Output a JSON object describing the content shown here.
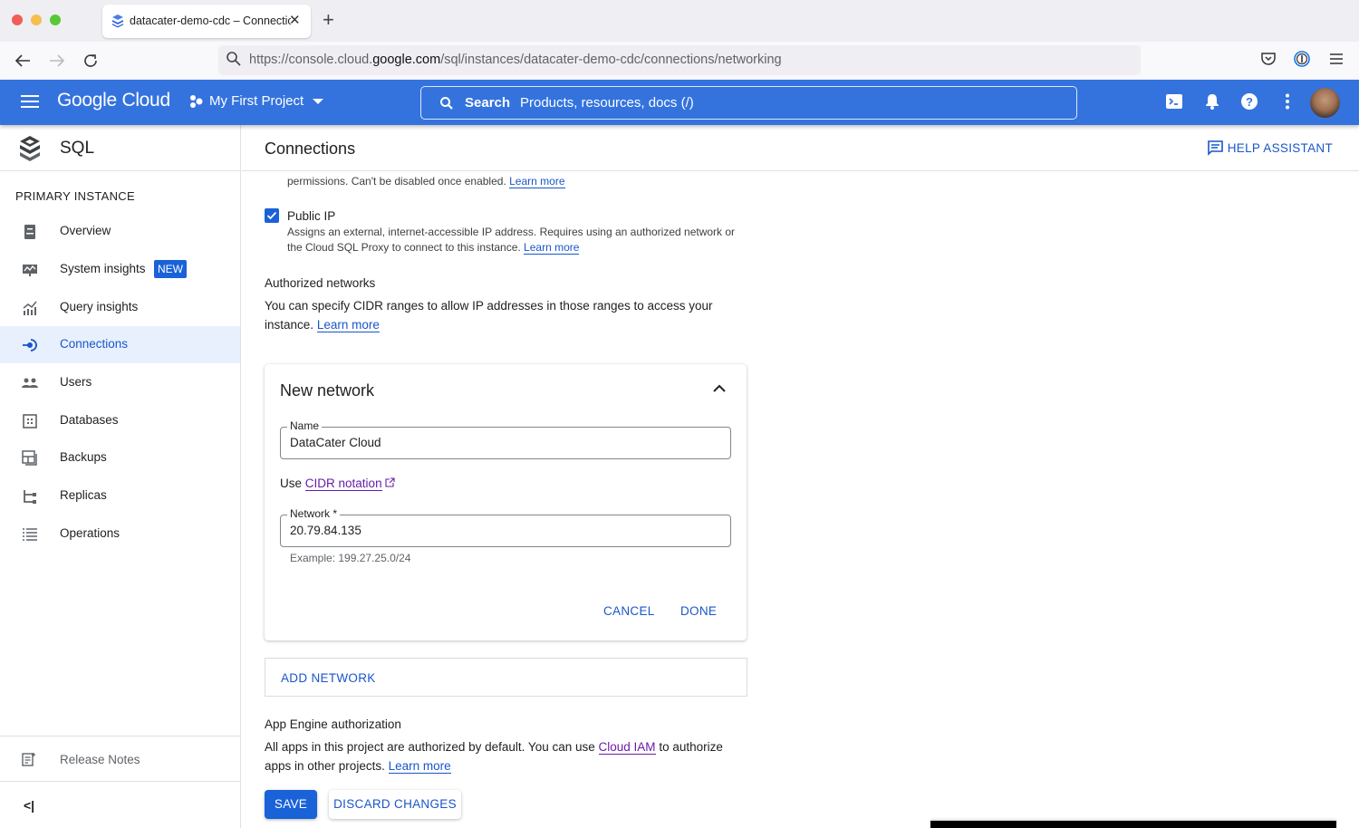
{
  "browser": {
    "tab_title": "datacater-demo-cdc – Connections",
    "new_tab_symbol": "+",
    "close_symbol": "✕",
    "url_prefix": "https://console.cloud.",
    "url_domain": "google.com",
    "url_path": "/sql/instances/datacater-demo-cdc/connections/networking"
  },
  "header": {
    "logo": "Google Cloud",
    "project": "My First Project",
    "search_label": "Search",
    "search_placeholder": "Products, resources, docs (/)"
  },
  "sidebar": {
    "product": "SQL",
    "section": "PRIMARY INSTANCE",
    "items": [
      {
        "label": "Overview",
        "icon": "overview-icon"
      },
      {
        "label": "System insights",
        "icon": "system-insights-icon",
        "badge": "NEW"
      },
      {
        "label": "Query insights",
        "icon": "query-insights-icon"
      },
      {
        "label": "Connections",
        "icon": "connections-icon",
        "active": true
      },
      {
        "label": "Users",
        "icon": "users-icon"
      },
      {
        "label": "Databases",
        "icon": "databases-icon"
      },
      {
        "label": "Backups",
        "icon": "backups-icon"
      },
      {
        "label": "Replicas",
        "icon": "replicas-icon"
      },
      {
        "label": "Operations",
        "icon": "operations-icon"
      }
    ],
    "release_notes": "Release Notes",
    "collapse_symbol": "<|"
  },
  "page": {
    "title": "Connections",
    "help_assistant": "HELP ASSISTANT",
    "cut_text": "permissions. Can't be disabled once enabled.",
    "learn_more": "Learn more",
    "public_ip": {
      "label": "Public IP",
      "checked": true,
      "description": "Assigns an external, internet-accessible IP address. Requires using an authorized network or the Cloud SQL Proxy to connect to this instance."
    },
    "authorized_networks": {
      "title": "Authorized networks",
      "description": "You can specify CIDR ranges to allow IP addresses in those ranges to access your instance."
    },
    "new_network": {
      "title": "New network",
      "name_label": "Name",
      "name_value": "DataCater Cloud",
      "use_text": "Use",
      "cidr_link": "CIDR notation",
      "network_label": "Network *",
      "network_value": "20.79.84.135",
      "example": "Example: 199.27.25.0/24",
      "cancel": "CANCEL",
      "done": "DONE"
    },
    "add_network": "ADD NETWORK",
    "app_engine": {
      "title": "App Engine authorization",
      "desc_part1": "All apps in this project are authorized by default. You can use",
      "cloud_iam": "Cloud IAM",
      "desc_part2": "to authorize apps in other projects."
    },
    "save": "SAVE",
    "discard": "DISCARD CHANGES"
  },
  "colors": {
    "brand_blue": "#3473de",
    "accent": "#1a56c9",
    "visited_link": "#681da8"
  }
}
